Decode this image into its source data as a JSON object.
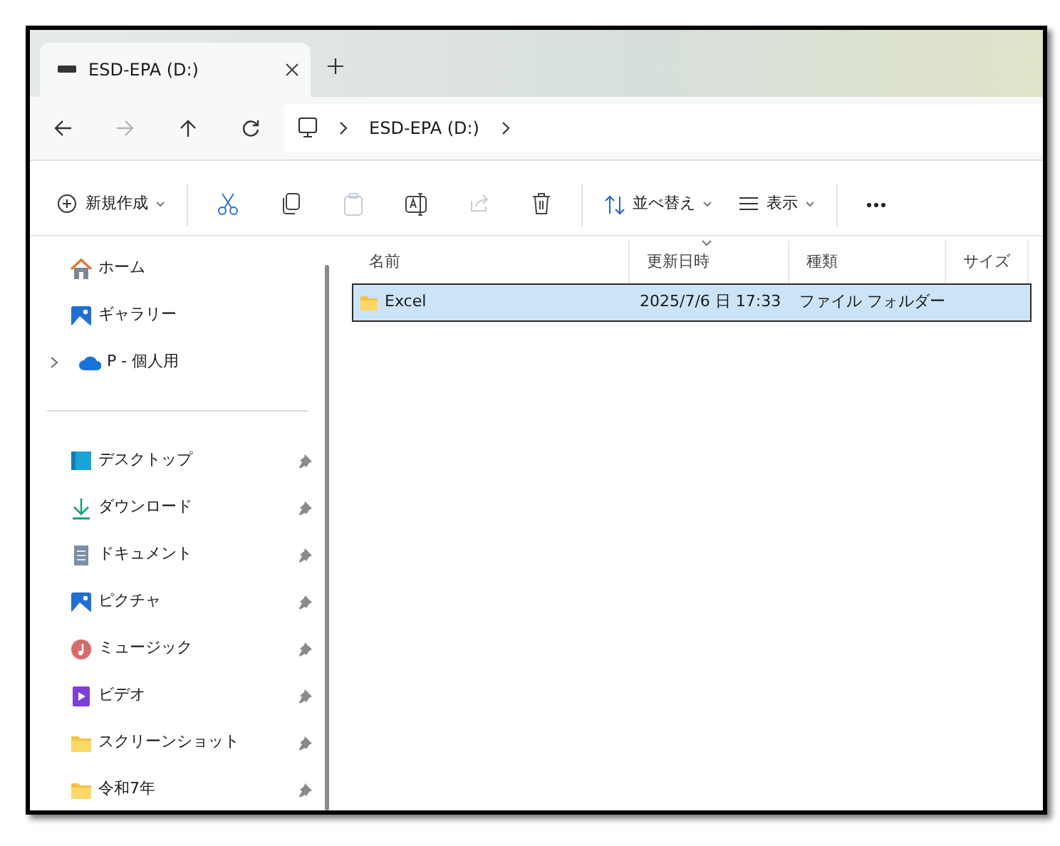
{
  "tabs": [
    {
      "label": "ESD-EPA (D:)",
      "selected": true
    }
  ],
  "nav": [
    {
      "disabled": false
    },
    {
      "disabled": true
    },
    {
      "disabled": false
    },
    {
      "disabled": false
    }
  ],
  "breadcrumb": [
    "ESD-EPA (D:)"
  ],
  "toolbar": [
    {
      "kind": "menu",
      "label": "新規作成"
    },
    {
      "kind": "icon",
      "disabled": false
    },
    {
      "kind": "icon",
      "disabled": false
    },
    {
      "kind": "icon",
      "disabled": true
    },
    {
      "kind": "icon",
      "disabled": false
    },
    {
      "kind": "icon",
      "disabled": true
    },
    {
      "kind": "icon",
      "disabled": false
    },
    {
      "kind": "menu",
      "label": "並べ替え"
    },
    {
      "kind": "menu",
      "label": "表示"
    },
    {
      "kind": "more"
    }
  ],
  "sidebar": {
    "top": [
      {
        "label": "ホーム",
        "expandable": false
      },
      {
        "label": "ギャラリー",
        "expandable": false
      },
      {
        "label": "P - 個人用",
        "expandable": true
      }
    ],
    "pinned": [
      {
        "label": "デスクトップ",
        "pinned": true
      },
      {
        "label": "ダウンロード",
        "pinned": true
      },
      {
        "label": "ドキュメント",
        "pinned": true
      },
      {
        "label": "ピクチャ",
        "pinned": true
      },
      {
        "label": "ミュージック",
        "pinned": true
      },
      {
        "label": "ビデオ",
        "pinned": true
      },
      {
        "label": "スクリーンショット",
        "pinned": true
      },
      {
        "label": "令和7年",
        "pinned": true
      }
    ]
  },
  "table": {
    "columns": [
      {
        "label": "名前",
        "sorted": false
      },
      {
        "label": "更新日時",
        "sorted": true
      },
      {
        "label": "種類",
        "sorted": false
      },
      {
        "label": "サイズ",
        "sorted": false
      }
    ],
    "rows": [
      {
        "name": "Excel",
        "modified": "2025/7/6 日 17:33",
        "type": "ファイル フォルダー",
        "selected": true
      }
    ]
  }
}
